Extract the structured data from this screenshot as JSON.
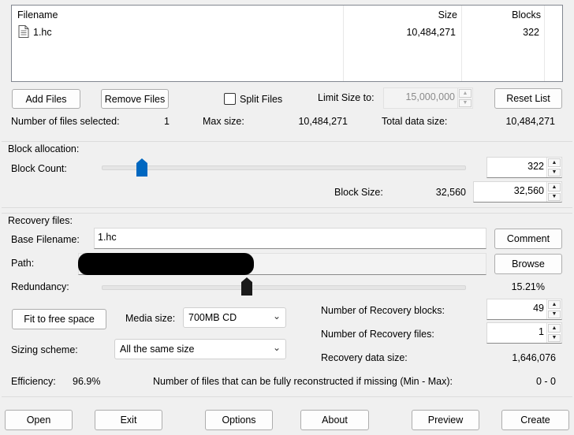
{
  "file_list": {
    "columns": {
      "filename": "Filename",
      "size": "Size",
      "blocks": "Blocks"
    },
    "rows": [
      {
        "filename": "1.hc",
        "size": "10,484,271",
        "blocks": "322"
      }
    ]
  },
  "file_buttons": {
    "add": "Add Files",
    "remove": "Remove Files",
    "split": "Split Files",
    "limit_label": "Limit Size to:",
    "limit_value": "15,000,000",
    "reset": "Reset List"
  },
  "file_stats": {
    "selected_label": "Number of files selected:",
    "selected_value": "1",
    "max_label": "Max size:",
    "max_value": "10,484,271",
    "total_label": "Total data size:",
    "total_value": "10,484,271"
  },
  "block_allocation": {
    "title": "Block allocation:",
    "count_label": "Block Count:",
    "count_value": "322",
    "count_slider_fraction": 0.11,
    "size_label": "Block Size:",
    "size_readout": "32,560",
    "size_value": "32,560"
  },
  "recovery": {
    "title": "Recovery files:",
    "base_label": "Base Filename:",
    "base_value": "1.hc",
    "comment": "Comment",
    "path_label": "Path:",
    "browse": "Browse",
    "redundancy_label": "Redundancy:",
    "redundancy_value": "15.21%",
    "redundancy_slider_fraction": 0.4,
    "fit_button": "Fit to free space",
    "media_label": "Media size:",
    "media_value": "700MB CD",
    "sizing_label": "Sizing scheme:",
    "sizing_value": "All the same size",
    "rec_blocks_label": "Number of Recovery blocks:",
    "rec_blocks_value": "49",
    "rec_files_label": "Number of Recovery files:",
    "rec_files_value": "1",
    "rec_size_label": "Recovery data size:",
    "rec_size_value": "1,646,076",
    "efficiency_label": "Efficiency:",
    "efficiency_value": "96.9%",
    "reconstruct_label": "Number of files that can be fully reconstructed if missing (Min - Max):",
    "reconstruct_value": "0 - 0"
  },
  "bottom_buttons": {
    "open": "Open",
    "exit": "Exit",
    "options": "Options",
    "about": "About",
    "preview": "Preview",
    "create": "Create"
  },
  "colors": {
    "accent": "#0067c0",
    "background": "#f0f0f0"
  },
  "icons": {
    "file": "file-icon"
  }
}
